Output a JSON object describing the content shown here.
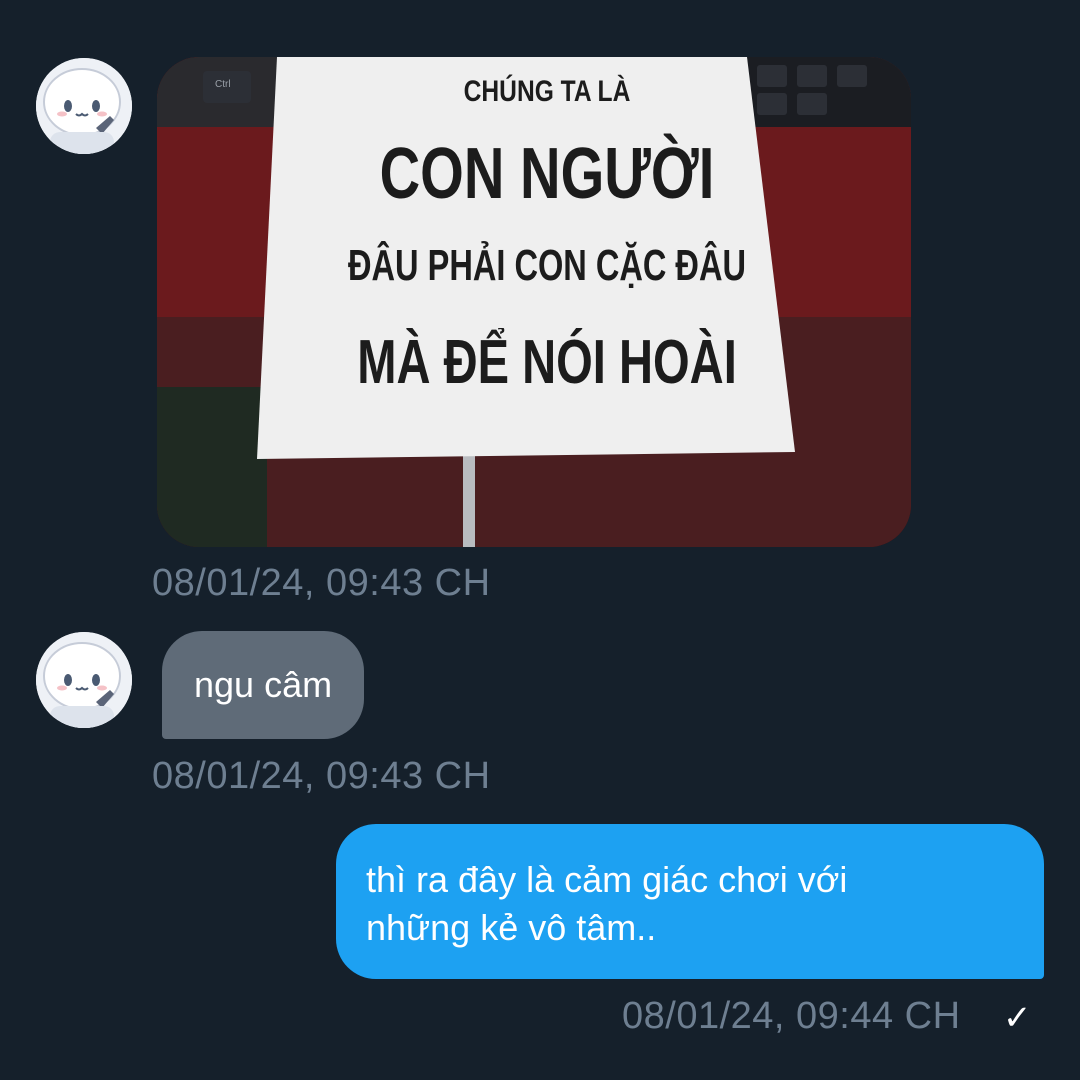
{
  "messages": [
    {
      "direction": "incoming",
      "type": "image",
      "image": {
        "sign_lines": [
          "CHÚNG TA LÀ",
          "CON NGƯỜI",
          "ĐÂU PHẢI CON CẶC ĐÂU",
          "MÀ ĐỂ NÓI HOÀI"
        ],
        "keyboard_key": "Ctrl"
      },
      "timestamp": "08/01/24, 09:43 CH"
    },
    {
      "direction": "incoming",
      "type": "text",
      "text": "ngu câm",
      "timestamp": "08/01/24, 09:43 CH"
    },
    {
      "direction": "outgoing",
      "type": "text",
      "lines": [
        "thì ra đây là cảm giác chơi với",
        "những kẻ vô tâm.."
      ],
      "timestamp": "08/01/24, 09:44 CH",
      "status_icon": "checkmark-icon",
      "status_glyph": "✓"
    }
  ],
  "colors": {
    "background": "#15202b",
    "incoming_bubble": "#5f6b78",
    "outgoing_bubble": "#1da1f2",
    "timestamp": "#6e7f91"
  }
}
